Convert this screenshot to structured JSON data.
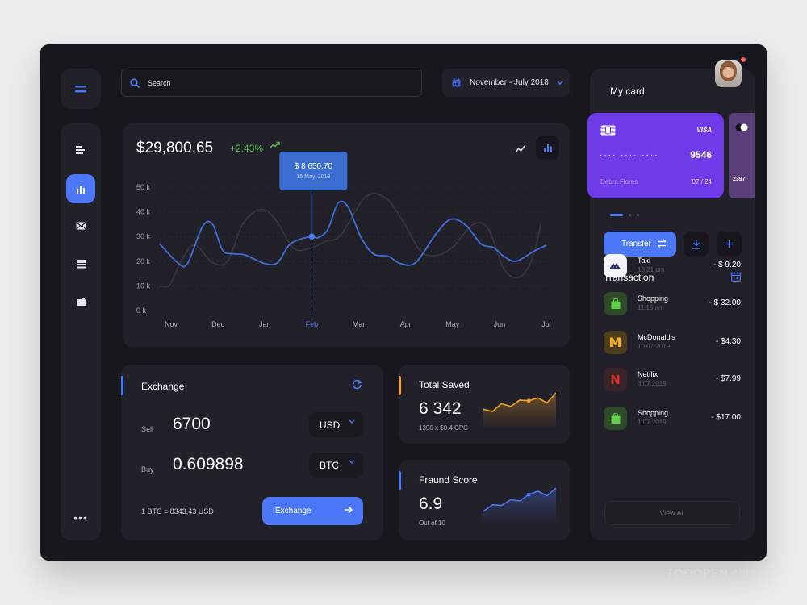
{
  "colors": {
    "accent": "#4c78f7",
    "positive": "#55c350",
    "orange": "#f5a623",
    "card_purple": "#6f3ae8",
    "card_secondary": "#5a3f7b",
    "notification": "#f25a5a"
  },
  "sidebar": {
    "menu_icon": "hamburger-icon",
    "items": [
      {
        "name": "list",
        "icon": "list-icon",
        "active": false
      },
      {
        "name": "analytics",
        "icon": "bar-chart-icon",
        "active": true
      },
      {
        "name": "messages",
        "icon": "mail-icon",
        "active": false
      },
      {
        "name": "documents",
        "icon": "stack-icon",
        "active": false
      },
      {
        "name": "wallet",
        "icon": "wallet-icon",
        "active": false
      }
    ],
    "more_label": "•••"
  },
  "header": {
    "search_placeholder": "Search",
    "date_range": "November - July 2018"
  },
  "overview": {
    "balance": "$29,800.65",
    "change": "+2.43%",
    "tooltip_value": "$ 8 650.70",
    "tooltip_date": "15 May, 2019"
  },
  "chart_data": {
    "type": "line",
    "title": "",
    "xlabel": "",
    "ylabel": "",
    "x": [
      "Nov",
      "Dec",
      "Jan",
      "Feb",
      "Mar",
      "Apr",
      "May",
      "Jun",
      "Jul"
    ],
    "highlight_x": "Feb",
    "y_ticks": [
      "0 k",
      "10 k",
      "20 k",
      "30 k",
      "40 k",
      "50 k"
    ],
    "ylim": [
      0,
      50000
    ],
    "grid": true,
    "series": [
      {
        "name": "primary",
        "color": "#3f6fd8",
        "points": [
          [
            0,
            27000
          ],
          [
            0.35,
            19500
          ],
          [
            0.55,
            19000
          ],
          [
            0.85,
            34000
          ],
          [
            1.05,
            35000
          ],
          [
            1.25,
            24500
          ],
          [
            1.45,
            23000
          ],
          [
            1.7,
            22500
          ],
          [
            2.1,
            19000
          ],
          [
            2.35,
            19500
          ],
          [
            2.6,
            27000
          ],
          [
            3.0,
            30000
          ],
          [
            3.15,
            29500
          ],
          [
            3.35,
            33000
          ],
          [
            3.55,
            43500
          ],
          [
            3.75,
            42000
          ],
          [
            4.0,
            30000
          ],
          [
            4.25,
            23000
          ],
          [
            4.55,
            22000
          ],
          [
            4.8,
            19000
          ],
          [
            5.1,
            19500
          ],
          [
            5.5,
            31000
          ],
          [
            5.8,
            37000
          ],
          [
            6.1,
            34500
          ],
          [
            6.4,
            27000
          ],
          [
            6.65,
            25500
          ],
          [
            6.85,
            22000
          ],
          [
            7.1,
            20000
          ],
          [
            7.45,
            24000
          ],
          [
            7.7,
            26500
          ]
        ]
      },
      {
        "name": "comparison",
        "color": "#3a3842",
        "points": [
          [
            0,
            10000
          ],
          [
            0.2,
            10500
          ],
          [
            0.45,
            21000
          ],
          [
            0.7,
            26500
          ],
          [
            1.05,
            19500
          ],
          [
            1.35,
            20000
          ],
          [
            1.65,
            35000
          ],
          [
            2.0,
            41000
          ],
          [
            2.3,
            37000
          ],
          [
            2.65,
            25500
          ],
          [
            2.95,
            25000
          ],
          [
            3.3,
            28000
          ],
          [
            3.6,
            30500
          ],
          [
            4.1,
            46000
          ],
          [
            4.5,
            45500
          ],
          [
            4.85,
            36000
          ],
          [
            5.2,
            24000
          ],
          [
            5.55,
            22500
          ],
          [
            5.85,
            26000
          ],
          [
            6.25,
            35000
          ],
          [
            6.55,
            33000
          ],
          [
            6.85,
            17000
          ],
          [
            7.15,
            13500
          ],
          [
            7.4,
            20000
          ],
          [
            7.6,
            35500
          ]
        ]
      }
    ],
    "annotation": {
      "x": "Feb",
      "value": "$ 8 650.70",
      "date": "15 May, 2019"
    }
  },
  "exchange": {
    "title": "Exchange",
    "sell_label": "Sell",
    "sell_value": "6700",
    "sell_currency": "USD",
    "buy_label": "Buy",
    "buy_value": "0.609898",
    "buy_currency": "BTC",
    "rate": "1 BTC =  8343,43 USD",
    "button": "Exchange"
  },
  "total_saved": {
    "title": "Total Saved",
    "value": "6 342",
    "subtitle": "1390 x $0.4 CPC",
    "sparkline": [
      22,
      19,
      30,
      26,
      35,
      34,
      38,
      31,
      45
    ]
  },
  "fraud_score": {
    "title": "Fraund Score",
    "value": "6.9",
    "subtitle": "Out of 10",
    "sparkline": [
      14,
      24,
      23,
      32,
      30,
      40,
      45,
      38,
      50
    ]
  },
  "my_card": {
    "title": "My card",
    "cards": [
      {
        "brand": "VISA",
        "masked": "····  ····  ····",
        "last4": "9546",
        "holder": "Debra Flores",
        "expiry": "07 / 24"
      },
      {
        "brand": "mastercard",
        "last4": "2397"
      }
    ],
    "pager": {
      "count": 3,
      "active": 0
    },
    "transfer_label": "Transfer"
  },
  "transactions": {
    "title": "Transaction",
    "items": [
      {
        "name": "Taxi",
        "time": "13:21 pm",
        "amount": "- $ 9.20",
        "icon": "taxi-icon",
        "logo_bg": "#f4f4f6",
        "logo_fg": "#2a2a6a"
      },
      {
        "name": "Shopping",
        "time": "11:15 am",
        "amount": "- $ 32.00",
        "icon": "shopping-bag-icon",
        "logo_bg": "#2f4a2b",
        "logo_fg": "#62d04a"
      },
      {
        "name": "McDonald's",
        "time": "10.07.2019",
        "amount": "- $4.30",
        "icon": "mcdonalds-icon",
        "logo_bg": "#4e3d1e",
        "logo_fg": "#f5b321"
      },
      {
        "name": "Netflix",
        "time": "3.07.2019",
        "amount": "- $7.99",
        "icon": "netflix-icon",
        "logo_bg": "#3a2328",
        "logo_fg": "#e3262c"
      },
      {
        "name": "Shopping",
        "time": "1.07.2019",
        "amount": "- $17.00",
        "icon": "shopping-bag-icon",
        "logo_bg": "#2f4a2b",
        "logo_fg": "#62d04a"
      }
    ],
    "view_all": "View All"
  },
  "watermark": "TOOOPEN.com"
}
